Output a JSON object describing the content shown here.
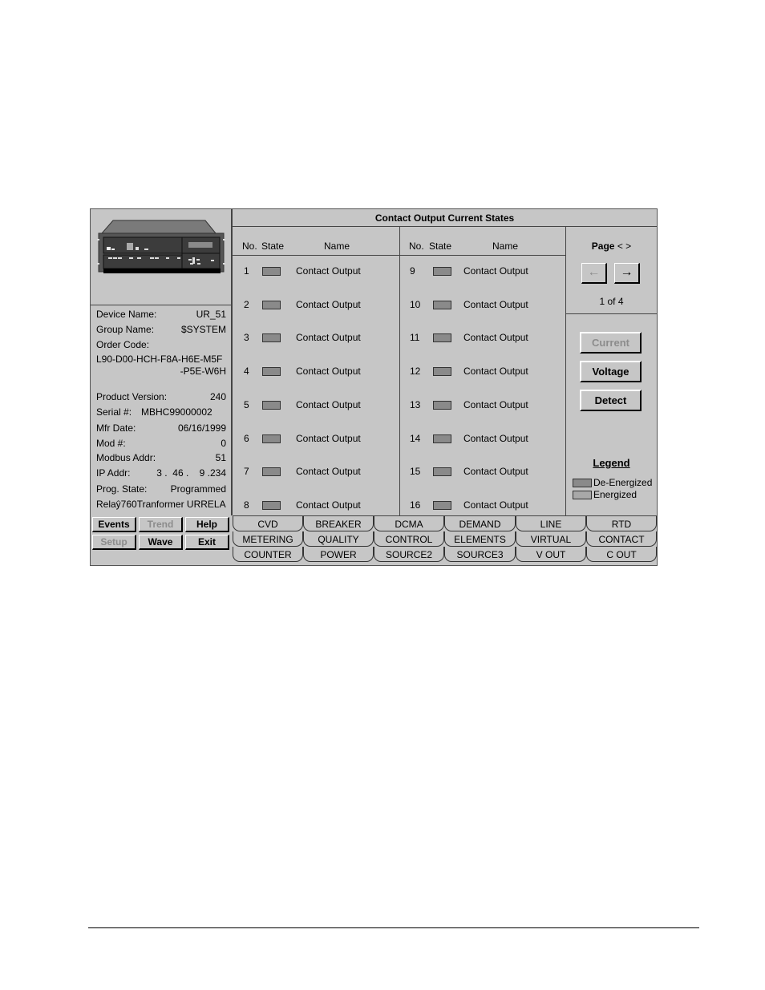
{
  "window": {
    "title": "Contact Output Current States"
  },
  "device_info": {
    "device_name_label": "Device Name:",
    "device_name": "UR_51",
    "group_name_label": "Group Name:",
    "group_name": "$SYSTEM",
    "order_code_label": "Order Code:",
    "order_code_line1": "L90-D00-HCH-F8A-H6E-M5F",
    "order_code_line2": "-P5E-W6H",
    "product_version_label": "Product Version:",
    "product_version": "240",
    "serial_label": "Serial #:",
    "serial": "MBHC99000002",
    "mfr_date_label": "Mfr Date:",
    "mfr_date": "06/16/1999",
    "mod_label": "Mod #:",
    "mod": "0",
    "modbus_label": "Modbus Addr:",
    "modbus": "51",
    "ip_label": "IP Addr:",
    "ip": "3 .  46 .    9 .234",
    "prog_state_label": "Prog. State:",
    "prog_state": "Programmed",
    "relay_desc": "Relaŷ760Tranformer URRELA"
  },
  "left_buttons": [
    {
      "label": "Events",
      "enabled": true
    },
    {
      "label": "Trend",
      "enabled": false
    },
    {
      "label": "Help",
      "enabled": true
    },
    {
      "label": "Setup",
      "enabled": false
    },
    {
      "label": "Wave",
      "enabled": true
    },
    {
      "label": "Exit",
      "enabled": true
    }
  ],
  "columns": {
    "no": "No.",
    "state": "State",
    "name": "Name"
  },
  "outputs": [
    {
      "no": "1",
      "name": "Contact Output",
      "state": "De-Energized"
    },
    {
      "no": "2",
      "name": "Contact Output",
      "state": "De-Energized"
    },
    {
      "no": "3",
      "name": "Contact Output",
      "state": "De-Energized"
    },
    {
      "no": "4",
      "name": "Contact Output",
      "state": "De-Energized"
    },
    {
      "no": "5",
      "name": "Contact Output",
      "state": "De-Energized"
    },
    {
      "no": "6",
      "name": "Contact Output",
      "state": "De-Energized"
    },
    {
      "no": "7",
      "name": "Contact Output",
      "state": "De-Energized"
    },
    {
      "no": "8",
      "name": "Contact Output",
      "state": "De-Energized"
    },
    {
      "no": "9",
      "name": "Contact Output",
      "state": "De-Energized"
    },
    {
      "no": "10",
      "name": "Contact Output",
      "state": "De-Energized"
    },
    {
      "no": "11",
      "name": "Contact Output",
      "state": "De-Energized"
    },
    {
      "no": "12",
      "name": "Contact Output",
      "state": "De-Energized"
    },
    {
      "no": "13",
      "name": "Contact Output",
      "state": "De-Energized"
    },
    {
      "no": "14",
      "name": "Contact Output",
      "state": "De-Energized"
    },
    {
      "no": "15",
      "name": "Contact Output",
      "state": "De-Energized"
    },
    {
      "no": "16",
      "name": "Contact Output",
      "state": "De-Energized"
    }
  ],
  "paging": {
    "label": "Page",
    "arrows_hint": "< >",
    "prev_icon": "←",
    "next_icon": "→",
    "current": "1 of 4"
  },
  "side_buttons": [
    {
      "label": "Current",
      "enabled": false
    },
    {
      "label": "Voltage",
      "enabled": true
    },
    {
      "label": "Detect",
      "enabled": true
    }
  ],
  "legend": {
    "title": "Legend",
    "items": [
      {
        "label": "De-Energized",
        "color": "#8a8a8a"
      },
      {
        "label": "Energized",
        "color": "#a8a8a8"
      }
    ]
  },
  "tabs": [
    [
      "CVD",
      "BREAKER",
      "DCMA",
      "DEMAND",
      "LINE",
      "RTD"
    ],
    [
      "METERING",
      "QUALITY",
      "CONTROL",
      "ELEMENTS",
      "VIRTUAL",
      "CONTACT"
    ],
    [
      "COUNTER",
      "POWER",
      "SOURCE2",
      "SOURCE3",
      "V OUT",
      "C OUT"
    ]
  ],
  "colors": {
    "panel_bg": "#c6c6c6",
    "state_deenergized": "#8a8a8a",
    "state_energized": "#a8a8a8",
    "disabled_text": "#8c8c8c"
  }
}
